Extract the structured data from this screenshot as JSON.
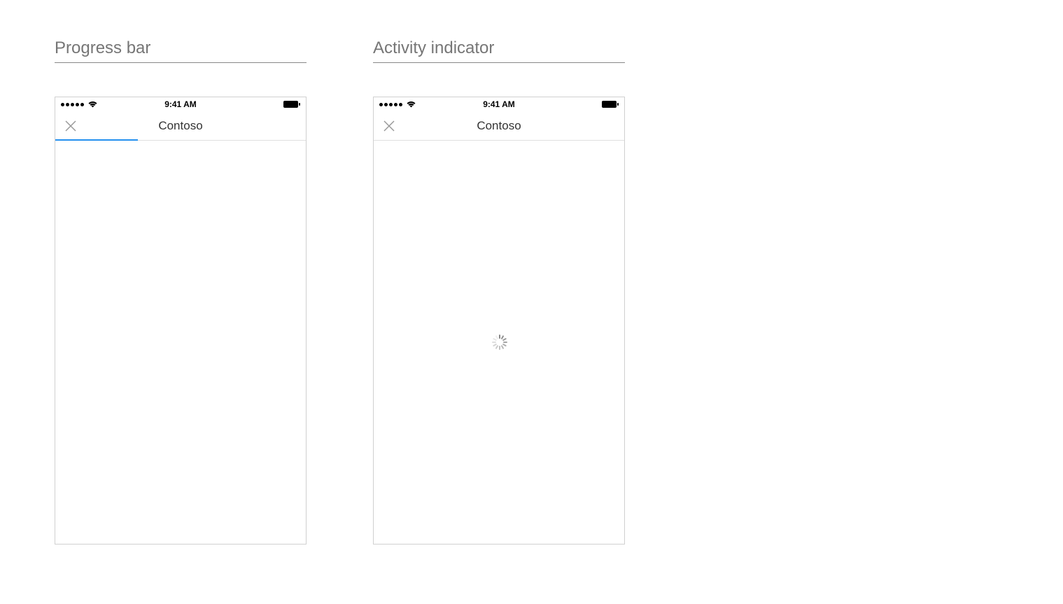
{
  "sections": {
    "progress": {
      "title": "Progress bar"
    },
    "activity": {
      "title": "Activity indicator"
    }
  },
  "status_bar": {
    "time": "9:41 AM",
    "signal_strength": 5
  },
  "nav": {
    "title": "Contoso"
  },
  "progress_bar": {
    "percent": 33
  },
  "colors": {
    "accent": "#2490ef",
    "title_text": "#767676"
  }
}
